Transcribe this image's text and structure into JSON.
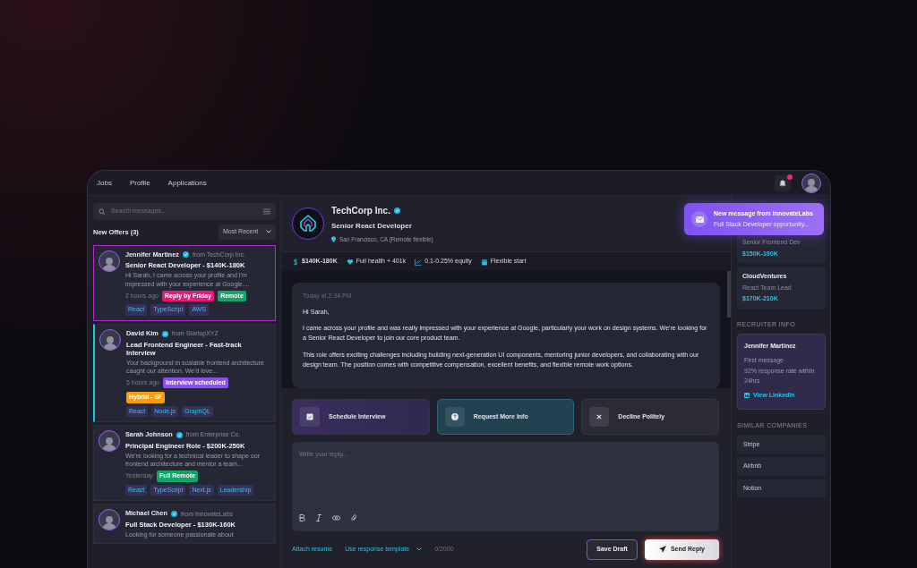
{
  "nav": {
    "items": [
      {
        "label": "Jobs"
      },
      {
        "label": "Profile"
      },
      {
        "label": "Applications"
      }
    ]
  },
  "sidebar": {
    "search_placeholder": "Search messages...",
    "heading": "New Offers (3)",
    "sort": "Most Recent",
    "offers": [
      {
        "name": "Jennifer Martinez",
        "company": "from TechCorp Inc.",
        "title": "Senior React Developer - $140K-180K",
        "preview": "Hi Sarah, I came across your profile and I'm impressed with your experience at Google....",
        "time": "2 hours ago",
        "selected": true,
        "highlighted": false,
        "tags": [
          {
            "label": "Reply by Friday",
            "color": "#e8177c"
          },
          {
            "label": "Remote",
            "color": "#16a36a"
          }
        ],
        "skills": [
          "React",
          "TypeScript",
          "AWS"
        ]
      },
      {
        "name": "David Kim",
        "company": "from StartupXYZ",
        "title": "Lead Frontend Engineer - Fast-track Interview",
        "preview": "Your background in scalable frontend architecture caught our attention. We'd love...",
        "time": "5 hours ago",
        "selected": false,
        "highlighted": true,
        "tags": [
          {
            "label": "Interview scheduled",
            "color": "#8b4ff0"
          },
          {
            "label": "Hybrid - SF",
            "color": "#f59e0b"
          }
        ],
        "skills": [
          "React",
          "Node.js",
          "GraphQL"
        ]
      },
      {
        "name": "Sarah Johnson",
        "company": "from Enterprise Co.",
        "title": "Principal Engineer Role - $200K-250K",
        "preview": "We're looking for a technical leader to shape our frontend architecture and mentor a team...",
        "time": "Yesterday",
        "selected": false,
        "highlighted": false,
        "tags": [
          {
            "label": "Full Remote",
            "color": "#16a36a"
          }
        ],
        "skills": [
          "React",
          "TypeScript",
          "Next.js",
          "Leadership"
        ]
      },
      {
        "name": "Michael Chen",
        "company": "from InnovateLabs",
        "title": "Full Stack Developer - $130K-160K",
        "preview": "Looking for someone passionate about",
        "selected": false,
        "highlighted": false
      }
    ]
  },
  "company": {
    "name": "TechCorp Inc.",
    "role": "Senior React Developer",
    "location": "San Francisco, CA (Remote flexible)"
  },
  "perks": [
    {
      "kind": "salary",
      "text": "$140K-180K"
    },
    {
      "kind": "health",
      "text": "Full health + 401k"
    },
    {
      "kind": "equity",
      "text": "0.1-0.25% equity"
    },
    {
      "kind": "start",
      "text": "Flexible start"
    }
  ],
  "message": {
    "time": "Today at 2:34 PM",
    "paragraphs": [
      "Hi Sarah,",
      "I came across your profile and was really impressed with your experience at Google, particularly your work on design systems. We're looking for a Senior React Developer to join our core product team.",
      "This role offers exciting challenges including building next-generation UI components, mentoring junior developers, and collaborating with our design team. The position comes with competitive compensation, excellent benefits, and flexible remote work options."
    ]
  },
  "actions": [
    {
      "kind": "schedule",
      "label": "Schedule Interview"
    },
    {
      "kind": "info",
      "label": "Request More Info"
    },
    {
      "kind": "decline",
      "label": "Decline Politely"
    }
  ],
  "reply": {
    "placeholder": "Write your reply...",
    "attach": "Attach resume",
    "template": "Use response template",
    "counter": "0/2000",
    "save": "Save Draft",
    "send": "Send Reply"
  },
  "similar_jobs": [
    {
      "role": "Senior Frontend Dev",
      "salary": "$150K-190K"
    },
    {
      "company": "CloudVentures",
      "role": "React Team Lead",
      "salary": "$170K-210K"
    }
  ],
  "recruiter": {
    "heading": "RECRUITER INFO",
    "name": "Jennifer Martinez",
    "lines": [
      "First message",
      "92% response rate within 24hrs"
    ],
    "link": "View LinkedIn"
  },
  "similar_companies": {
    "heading": "SIMILAR COMPANIES",
    "items": [
      "Stripe",
      "Airbnb",
      "Notion"
    ]
  },
  "toast": {
    "title": "New message from InnovateLabs",
    "text": "Full Stack Developer opportunity..."
  }
}
